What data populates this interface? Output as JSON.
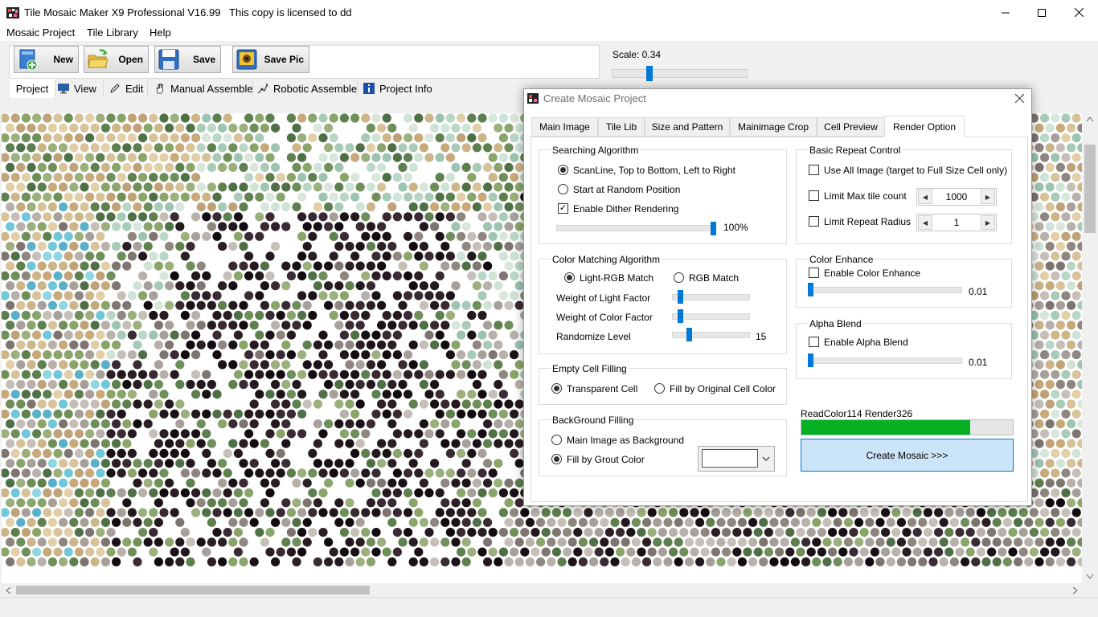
{
  "window": {
    "title": "Tile Mosaic Maker X9 Professional V16.99   This copy is licensed to dd"
  },
  "menu": [
    "Mosaic Project",
    "Tile Library",
    "Help"
  ],
  "toolbar": {
    "new_label": "New",
    "open_label": "Open",
    "save_label": "Save",
    "savepic_label": "Save Pic",
    "scale_label": "Scale: 0.34",
    "scale_value": 0.34
  },
  "nav_tabs": [
    "Project",
    "View",
    "Edit",
    "Manual Assemble",
    "Robotic Assemble",
    "Project Info"
  ],
  "dialog": {
    "title": "Create Mosaic Project",
    "tabs": [
      "Main Image",
      "Tile Lib",
      "Size and Pattern",
      "Mainimage Crop",
      "Cell Preview",
      "Render Option"
    ],
    "active_tab": "Render Option",
    "searching": {
      "title": "Searching Algorithm",
      "opt1": "ScanLine, Top to Bottom, Left to Right",
      "opt2": "Start at Random Position",
      "dither": "Enable Dither Rendering",
      "dither_percent": "100%"
    },
    "color_matching": {
      "title": "Color Matching Algorithm",
      "opt1": "Light-RGB Match",
      "opt2": "RGB Match",
      "light_factor": "Weight of Light Factor",
      "color_factor": "Weight of Color Factor",
      "randomize": "Randomize Level",
      "randomize_value": "15"
    },
    "empty_cell": {
      "title": "Empty Cell Filling",
      "opt1": "Transparent Cell",
      "opt2": "Fill by Original Cell Color"
    },
    "background": {
      "title": "BackGround Filling",
      "opt1": "Main Image as Background",
      "opt2": "Fill by Grout Color",
      "grout_color": "#ffffff"
    },
    "repeat": {
      "title": "Basic Repeat Control",
      "use_all": "Use All Image (target to Full Size Cell only)",
      "limit_max": "Limit Max tile count",
      "limit_max_value": "1000",
      "limit_radius": "Limit Repeat Radius",
      "limit_radius_value": "1"
    },
    "color_enhance": {
      "title": "Color Enhance",
      "enable": "Enable Color Enhance",
      "value": "0.01"
    },
    "alpha_blend": {
      "title": "Alpha Blend",
      "enable": "Enable Alpha Blend",
      "value": "0.01"
    },
    "status": "ReadColor114  Render326",
    "progress": 0.8,
    "create_label": "Create Mosaic >>>"
  },
  "colors": {
    "accent": "#0078d7",
    "progress": "#06b025",
    "button_hover": "#cce4f7"
  }
}
